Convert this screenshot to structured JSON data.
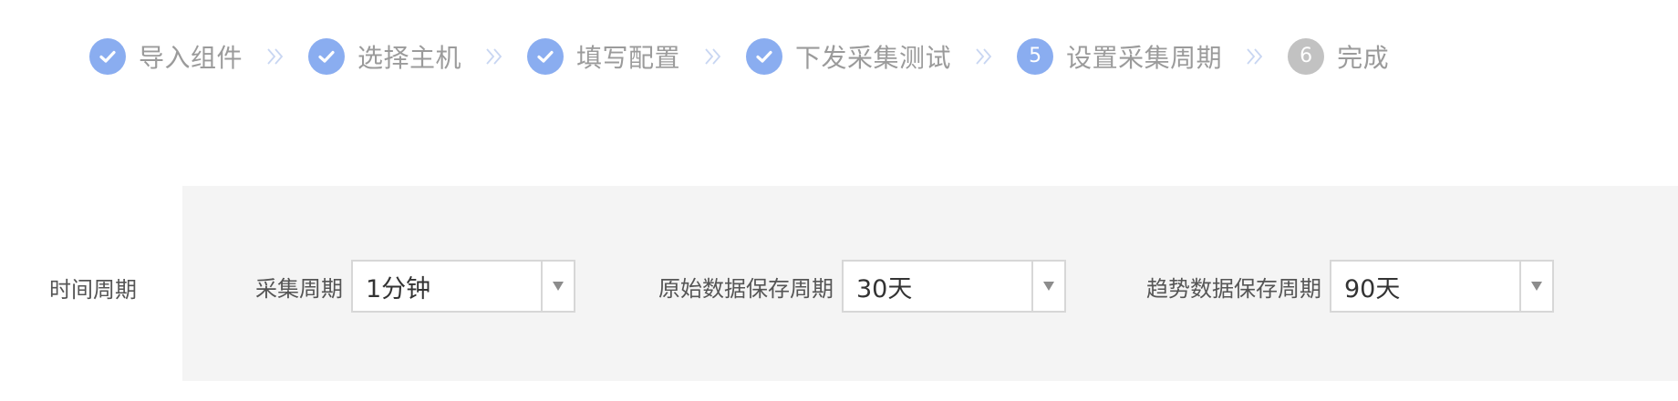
{
  "stepper": {
    "steps": [
      {
        "number": "",
        "label": "导入组件",
        "state": "done"
      },
      {
        "number": "",
        "label": "选择主机",
        "state": "done"
      },
      {
        "number": "",
        "label": "填写配置",
        "state": "done"
      },
      {
        "number": "",
        "label": "下发采集测试",
        "state": "done"
      },
      {
        "number": "5",
        "label": "设置采集周期",
        "state": "current"
      },
      {
        "number": "6",
        "label": "完成",
        "state": "pending"
      }
    ]
  },
  "settings": {
    "row_label": "时间周期",
    "fields": [
      {
        "label": "采集周期",
        "value": "1分钟"
      },
      {
        "label": "原始数据保存周期",
        "value": "30天"
      },
      {
        "label": "趋势数据保存周期",
        "value": "90天"
      }
    ]
  },
  "colors": {
    "step_active": "#8aadf0",
    "step_pending": "#c2c2c2",
    "step_label": "#9b9b9b",
    "separator": "#c8d6f2",
    "panel_bg": "#f4f4f4",
    "field_border": "#d7d7d7"
  }
}
